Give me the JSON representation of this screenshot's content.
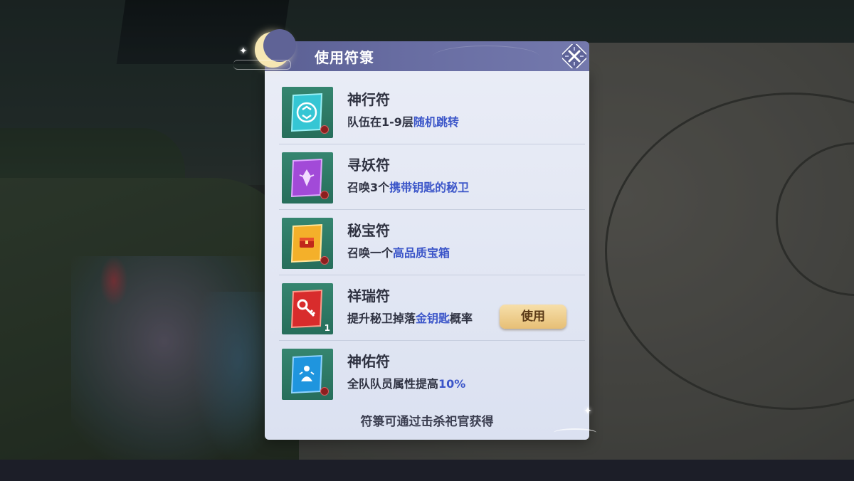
{
  "dialog": {
    "title": "使用符箓",
    "footer": "符箓可通过击杀祀官获得",
    "use_label": "使用"
  },
  "talismans": [
    {
      "name": "神行符",
      "desc_plain": "队伍在1-9层",
      "desc_hl": "随机跳转",
      "desc_tail": "",
      "quantity": "",
      "color": "#2fb7c8",
      "icon": "teleport-talisman-icon"
    },
    {
      "name": "寻妖符",
      "desc_plain": "召唤3个",
      "desc_hl": "携带钥匙的秘卫",
      "desc_tail": "",
      "quantity": "",
      "color": "#9b3fd0",
      "icon": "seek-demon-talisman-icon"
    },
    {
      "name": "秘宝符",
      "desc_plain": "召唤一个",
      "desc_hl": "高品质宝箱",
      "desc_tail": "",
      "quantity": "",
      "color": "#f0a81e",
      "icon": "treasure-talisman-icon"
    },
    {
      "name": "祥瑞符",
      "desc_plain": "提升秘卫掉落",
      "desc_hl": "金钥匙",
      "desc_tail": "概率",
      "quantity": "1",
      "color": "#d42a2a",
      "icon": "key-talisman-icon"
    },
    {
      "name": "神佑符",
      "desc_plain": "全队队员属性提高",
      "desc_hl": "10%",
      "desc_tail": "",
      "quantity": "",
      "color": "#1b8fd6",
      "icon": "blessing-talisman-icon"
    }
  ]
}
